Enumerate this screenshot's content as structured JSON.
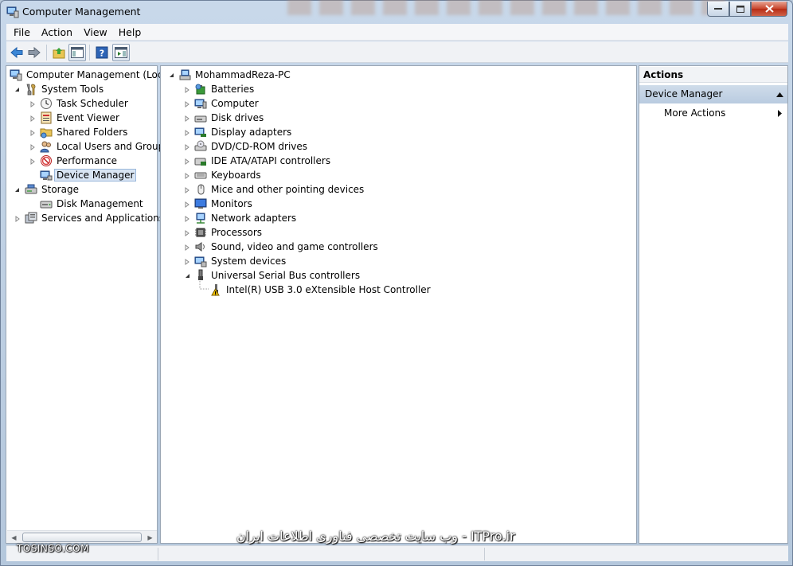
{
  "window": {
    "title": "Computer Management",
    "background_title": ""
  },
  "menu": {
    "items": [
      "File",
      "Action",
      "View",
      "Help"
    ]
  },
  "left_tree": {
    "root": "Computer Management (Local",
    "system_tools": "System Tools",
    "task_scheduler": "Task Scheduler",
    "event_viewer": "Event Viewer",
    "shared_folders": "Shared Folders",
    "local_users": "Local Users and Groups",
    "performance": "Performance",
    "device_manager": "Device Manager",
    "storage": "Storage",
    "disk_management": "Disk Management",
    "services": "Services and Applications"
  },
  "device_tree": {
    "computer_name": "MohammadReza-PC",
    "categories": [
      "Batteries",
      "Computer",
      "Disk drives",
      "Display adapters",
      "DVD/CD-ROM drives",
      "IDE ATA/ATAPI controllers",
      "Keyboards",
      "Mice and other pointing devices",
      "Monitors",
      "Network adapters",
      "Processors",
      "Sound, video and game controllers",
      "System devices",
      "Universal Serial Bus controllers"
    ],
    "usb_child": "Intel(R) USB 3.0 eXtensible Host Controller"
  },
  "actions": {
    "header": "Actions",
    "section": "Device Manager",
    "more_actions": "More Actions"
  },
  "watermarks": {
    "left": "TOSINSO.COM",
    "right": "ITPro.ir - وب سایت تخصصی فناوری اطلاعات ایران"
  },
  "colors": {
    "selection": "#d9e5f3",
    "actions_section": "#c4d4e6",
    "warning": "#f2c200"
  }
}
